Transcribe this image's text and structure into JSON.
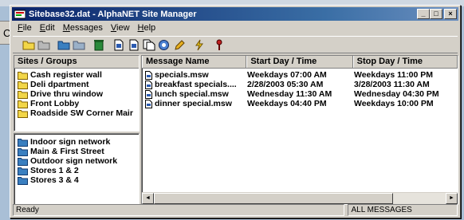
{
  "window": {
    "title": "Sitebase32.dat - AlphaNET Site Manager",
    "minimize": "_",
    "maximize": "□",
    "close": "×"
  },
  "background_fragment": "C",
  "menu": [
    {
      "underline": "F",
      "rest": "ile"
    },
    {
      "underline": "E",
      "rest": "dit"
    },
    {
      "underline": "M",
      "rest": "essages"
    },
    {
      "underline": "V",
      "rest": "iew"
    },
    {
      "underline": "H",
      "rest": "elp"
    }
  ],
  "toolbar": {
    "icons": [
      "open-folder-icon",
      "save-icon",
      "site-folder-icon",
      "network-folder-icon",
      "trash-icon",
      "new-message-icon",
      "edit-message-icon",
      "copy-message-icon",
      "settings-icon",
      "pencil-icon",
      "send-icon",
      "help-icon"
    ]
  },
  "groups": {
    "header": "Sites / Groups",
    "sites": [
      "Cash register wall",
      "Deli dpartment",
      "Drive thru window",
      "Front Lobby",
      "Roadside SW Corner Mair"
    ],
    "networks": [
      "Indoor sign network",
      "Main & First Street",
      "Outdoor sign network",
      "Stores 1 & 2",
      "Stores 3 & 4"
    ]
  },
  "messages": {
    "columns": [
      "Message Name",
      "Start Day / Time",
      "Stop Day / Time"
    ],
    "rows": [
      {
        "name": "specials.msw",
        "start": "Weekdays 07:00 AM",
        "stop": "Weekdays 11:00 PM"
      },
      {
        "name": "breakfast specials....",
        "start": "2/28/2003 05:30 AM",
        "stop": "3/28/2003 11:30 AM"
      },
      {
        "name": "lunch special.msw",
        "start": "Wednesday 11:30 AM",
        "stop": "Wednesday 04:30 PM"
      },
      {
        "name": "dinner special.msw",
        "start": "Weekdays 04:40 PM",
        "stop": "Weekdays 10:00 PM"
      }
    ]
  },
  "scrollbar": {
    "left_arrow": "◄",
    "right_arrow": "►"
  },
  "status": {
    "left": "Ready",
    "right": "ALL MESSAGES"
  },
  "colors": {
    "titlebar_start": "#0a246a",
    "folder_yellow": "#f2d648",
    "network_blue": "#3a7fc0"
  }
}
